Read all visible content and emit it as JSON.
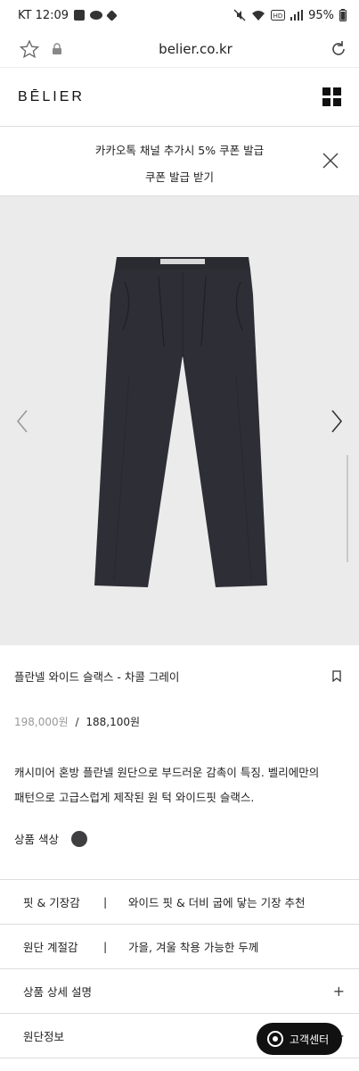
{
  "status_bar": {
    "carrier_time": "KT 12:09",
    "battery": "95%"
  },
  "browser": {
    "url": "belier.co.kr"
  },
  "header": {
    "logo": "BĒLIER"
  },
  "banner": {
    "text": "카카오톡 채널 추가시 5% 쿠폰 발급",
    "link": "쿠폰 발급 받기"
  },
  "product": {
    "title": "플란넬 와이드 슬랙스 - 차콜 그레이",
    "price_original": "198,000원",
    "price_separator": "/",
    "price_sale": "188,100원",
    "description": [
      "캐시미어 혼방 플란넬 원단으로 부드러운 감촉이 특징. 벨리에만의",
      "패턴으로 고급스럽게 제작된 원 턱 와이드핏 슬랙스."
    ],
    "color_label": "상품 색상",
    "color_hex": "#3f3f42"
  },
  "info_rows": [
    {
      "key": "핏 & 기장감",
      "bar": "|",
      "value": "와이드 핏 & 더비 굽에 닿는 기장 추천"
    },
    {
      "key": "원단 계절감",
      "bar": "|",
      "value": "가을, 겨울 착용 가능한 두께"
    },
    {
      "key": "상품 상세 설명",
      "plus": "+"
    },
    {
      "key": "원단정보",
      "plus": "+"
    }
  ],
  "cs_button": {
    "label": "고객센터"
  }
}
